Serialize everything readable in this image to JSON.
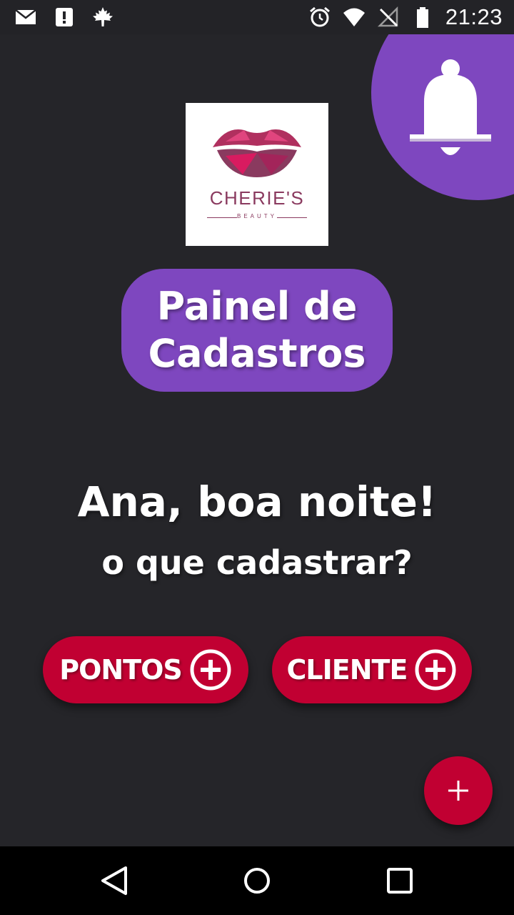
{
  "status_bar": {
    "time": "21:23",
    "left_icons": [
      "mail-icon",
      "alert-icon",
      "maple-leaf-icon"
    ],
    "right_icons": [
      "alarm-icon",
      "wifi-icon",
      "no-signal-icon",
      "battery-icon"
    ]
  },
  "logo": {
    "brand": "CHERIE'S",
    "subtitle": "BEAUTY",
    "colors": {
      "primary": "#8a3a5f",
      "accent": "#d81b60"
    }
  },
  "title": {
    "line1": "Painel de",
    "line2": "Cadastros"
  },
  "greeting": {
    "salutation": "Ana, boa noite!",
    "question": "o que cadastrar?"
  },
  "actions": {
    "pontos_label": "PONTOS",
    "cliente_label": "CLIENTE"
  },
  "fab": {
    "icon": "plus-icon"
  },
  "notification": {
    "icon": "bell-icon"
  },
  "navigation": {
    "icons": [
      "back-icon",
      "home-icon",
      "recent-apps-icon"
    ]
  },
  "colors": {
    "background": "#252529",
    "purple": "#7e47bf",
    "crimson": "#c10032",
    "text": "#ffffff"
  }
}
